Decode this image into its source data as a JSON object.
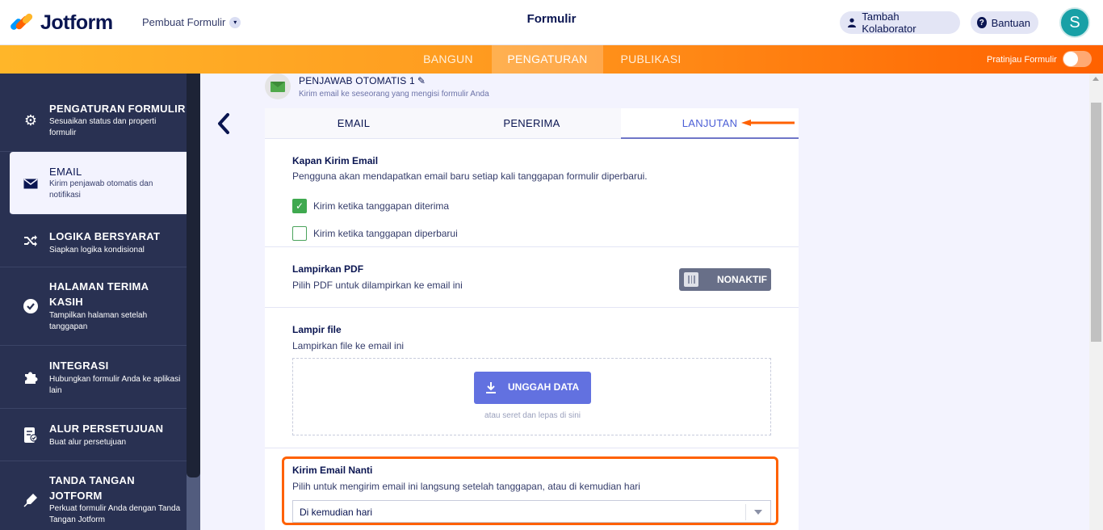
{
  "header": {
    "brand": "Jotform",
    "builder_selector": "Pembuat Formulir",
    "form_title": "Formulir",
    "collaborator_button": "Tambah Kolaborator",
    "help_button": "Bantuan",
    "avatar_initial": "S"
  },
  "main_tabs": {
    "build": "BANGUN",
    "settings": "PENGATURAN",
    "publish": "PUBLIKASI",
    "preview_label": "Pratinjau Formulir"
  },
  "sidebar": {
    "items": [
      {
        "title": "PENGATURAN FORMULIR",
        "desc": "Sesuaikan status dan properti formulir"
      },
      {
        "title": "EMAIL",
        "desc": "Kirim penjawab otomatis dan notifikasi"
      },
      {
        "title": "LOGIKA BERSYARAT",
        "desc": "Siapkan logika kondisional"
      },
      {
        "title": "HALAMAN TERIMA KASIH",
        "desc": "Tampilkan halaman setelah tanggapan"
      },
      {
        "title": "INTEGRASI",
        "desc": "Hubungkan formulir Anda ke aplikasi lain"
      },
      {
        "title": "ALUR PERSETUJUAN",
        "desc": "Buat alur persetujuan"
      },
      {
        "title": "TANDA TANGAN JOTFORM",
        "desc": "Perkuat formulir Anda dengan Tanda Tangan Jotform"
      }
    ]
  },
  "responder": {
    "title": "PENJAWAB OTOMATIS 1",
    "subtitle": "Kirim email ke seseorang yang mengisi formulir Anda"
  },
  "panel_tabs": {
    "email": "EMAIL",
    "recipient": "PENERIMA",
    "advanced": "LANJUTAN"
  },
  "send_when": {
    "title": "Kapan Kirim Email",
    "desc": "Pengguna akan mendapatkan email baru setiap kali tanggapan formulir diperbarui.",
    "option_received": "Kirim ketika tanggapan diterima",
    "option_received_checked": true,
    "option_updated": "Kirim ketika tanggapan diperbarui",
    "option_updated_checked": false
  },
  "attach_pdf": {
    "title": "Lampirkan PDF",
    "desc": "Pilih PDF untuk dilampirkan ke email ini",
    "toggle_label": "NONAKTIF"
  },
  "attach_file": {
    "title": "Lampir file",
    "desc": "Lampirkan file ke email ini",
    "upload_button": "UNGGAH DATA",
    "drop_hint": "atau seret dan lepas di sini"
  },
  "send_later": {
    "title": "Kirim Email Nanti",
    "desc": "Pilih untuk mengirim email ini langsung setelah tanggapan, atau di kemudian hari",
    "selected": "Di kemudian hari"
  },
  "colors": {
    "accent_orange": "#ff6100",
    "active_tab": "#4c5fd6",
    "checkbox_green": "#3fa94f",
    "upload_button": "#6271e0",
    "sidebar_bg": "#293152"
  }
}
